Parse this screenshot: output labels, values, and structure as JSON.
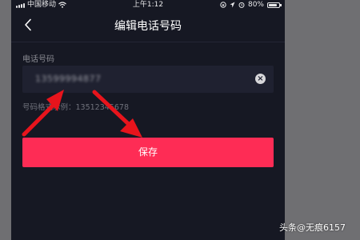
{
  "status_bar": {
    "carrier": "中国移动",
    "time": "上午1:12",
    "battery_percent": "80%",
    "battery_level": 0.8,
    "icons": [
      "signal-icon",
      "wifi-icon",
      "screen-lock-icon",
      "location-icon",
      "alarm-icon",
      "battery-icon"
    ]
  },
  "header": {
    "title": "编辑电话号码",
    "back_icon": "chevron-left-icon"
  },
  "form": {
    "phone_label": "电话号码",
    "phone_value": "13599994877",
    "clear_icon": "clear-icon",
    "hint": "号码格式示例：13512345678"
  },
  "save_label": "保存",
  "annotation_color": "#e8141c",
  "accent_color": "#fe2c55",
  "watermark": "头条@无痕6157"
}
